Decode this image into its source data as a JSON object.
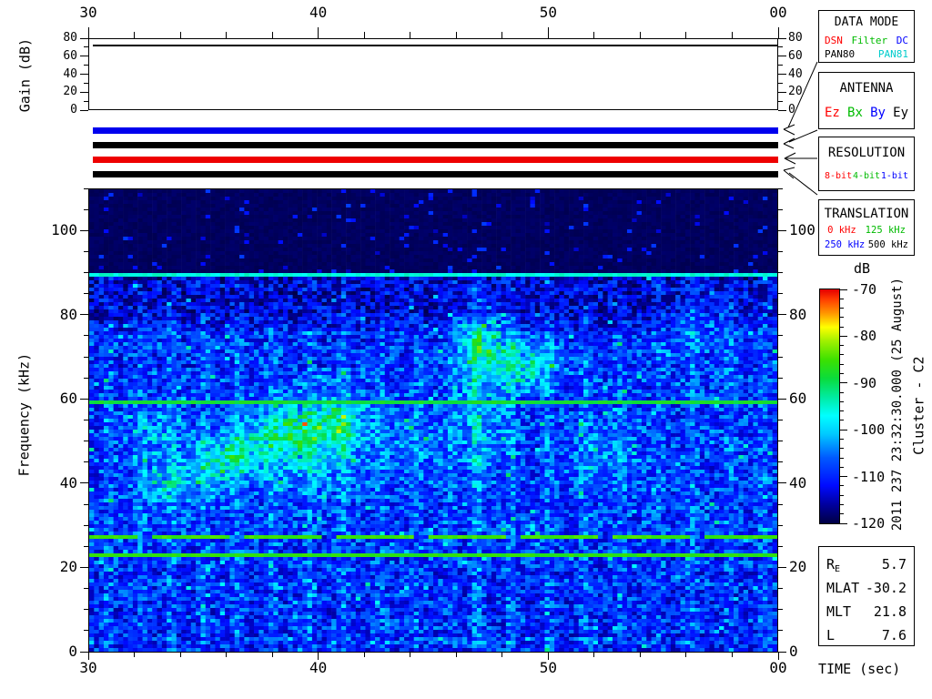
{
  "gain_panel": {
    "ylabel": "Gain (dB)",
    "tick_labels": [
      "0",
      "20",
      "40",
      "60",
      "80"
    ],
    "ymax_db": 80,
    "minor_step_db": 10,
    "major_step_db": 20,
    "trace_db": 72
  },
  "time_axis": {
    "label": "TIME (sec)",
    "tick_labels": [
      "30",
      "40",
      "50",
      "00"
    ],
    "start_sec": 30,
    "end_sec": 60,
    "minor_step_sec": 2,
    "major_step_sec": 10
  },
  "freq_axis": {
    "ylabel": "Frequency (kHz)",
    "tick_labels": [
      "0",
      "20",
      "40",
      "60",
      "80",
      "100"
    ],
    "max_khz": 110,
    "minor_step_khz": 5,
    "major_step_khz": 20
  },
  "mode_bars": [
    {
      "name": "mode-bar-blue",
      "color": "#0000ee"
    },
    {
      "name": "mode-bar-black-1",
      "color": "#000000"
    },
    {
      "name": "mode-bar-red",
      "color": "#ee0000"
    },
    {
      "name": "mode-bar-black-2",
      "color": "#000000"
    }
  ],
  "info_boxes": {
    "data_mode": {
      "title": "DATA MODE",
      "line1": [
        {
          "text": "DSN",
          "color": "#ff0000"
        },
        {
          "text": "Filter",
          "color": "#00bb00"
        },
        {
          "text": "DC",
          "color": "#0000ff"
        }
      ],
      "line2": [
        {
          "text": "PAN80",
          "color": "#000000"
        },
        {
          "text": "PAN81",
          "color": "#00cccc"
        }
      ]
    },
    "antenna": {
      "title": "ANTENNA",
      "items": [
        {
          "text": "Ez",
          "color": "#ff0000"
        },
        {
          "text": "Bx",
          "color": "#00bb00"
        },
        {
          "text": "By",
          "color": "#0000ff"
        },
        {
          "text": "Ey",
          "color": "#000000"
        }
      ]
    },
    "resolution": {
      "title": "RESOLUTION",
      "items": [
        {
          "text": "8-bit",
          "color": "#ff0000"
        },
        {
          "text": "4-bit",
          "color": "#00bb00"
        },
        {
          "text": "1-bit",
          "color": "#0000ff"
        }
      ]
    },
    "translation": {
      "title": "TRANSLATION",
      "line1": [
        {
          "text": "0 kHz",
          "color": "#ff0000"
        },
        {
          "text": "125 kHz",
          "color": "#00bb00"
        }
      ],
      "line2": [
        {
          "text": "250 kHz",
          "color": "#0000ff"
        },
        {
          "text": "500 kHz",
          "color": "#000000"
        }
      ]
    }
  },
  "colorbar": {
    "label": "dB",
    "tick_labels": [
      "-70",
      "-80",
      "-90",
      "-100",
      "-110",
      "-120"
    ],
    "max_db": -70,
    "min_db": -120,
    "minor_step_db": 2
  },
  "annotations": {
    "datetime": "2011 237 23:32:30.000 (25 August)",
    "spacecraft": "Cluster - C2"
  },
  "ephemeris": {
    "rows": [
      {
        "label": "R",
        "sub": "E",
        "value": "5.7"
      },
      {
        "label": "MLAT",
        "sub": "",
        "value": "-30.2"
      },
      {
        "label": "MLT",
        "sub": "",
        "value": "21.8"
      },
      {
        "label": "L",
        "sub": "",
        "value": "7.6"
      }
    ]
  },
  "chart_data": {
    "type": "heatmap",
    "title": "Cluster C2 wideband spectrogram",
    "xlabel": "TIME (sec)",
    "ylabel": "Frequency (kHz)",
    "x_ticks": [
      "30",
      "40",
      "50",
      "00"
    ],
    "x_range_sec": [
      30,
      60
    ],
    "y_range_khz": [
      0,
      110
    ],
    "value_range_db": [
      -120,
      -70
    ],
    "colorbar_label": "dB",
    "grid": {
      "cols": 142,
      "rows": 127
    },
    "noise": {
      "floor_db": -116,
      "spread_db": 13,
      "seed": 20110825
    },
    "upper_cutoff_khz": 90.3,
    "dark_background_db": -119.5,
    "high_band_darkening": {
      "from_khz": 76,
      "to_khz": 90,
      "amount_db": 3.5
    },
    "midband_boost": {
      "center_khz": 45,
      "sigma_khz": 25,
      "amount_db": 1.5
    },
    "spectral_lines": [
      {
        "freq_khz": 89.9,
        "level_db": -96,
        "style": "solid"
      },
      {
        "freq_khz": 58.9,
        "level_db": -89,
        "style": "solid"
      },
      {
        "freq_khz": 27.4,
        "level_db": -86,
        "style": "dashed"
      },
      {
        "freq_khz": 23.2,
        "level_db": -87,
        "style": "solid"
      }
    ],
    "stripes_sec_amp": [
      [
        30.8,
        3
      ],
      [
        32.3,
        3
      ],
      [
        33.6,
        4
      ],
      [
        35.0,
        4
      ],
      [
        36.5,
        4
      ],
      [
        38.0,
        4.5
      ],
      [
        39.6,
        4
      ],
      [
        41.1,
        4.5
      ],
      [
        42.7,
        3
      ],
      [
        44.3,
        3
      ],
      [
        45.8,
        3
      ],
      [
        46.9,
        7
      ],
      [
        48.4,
        4.5
      ],
      [
        50.0,
        4
      ],
      [
        51.6,
        4
      ],
      [
        53.2,
        3
      ],
      [
        54.8,
        3
      ],
      [
        56.3,
        4
      ],
      [
        57.9,
        3
      ],
      [
        59.4,
        3
      ]
    ],
    "blobs": [
      {
        "t_sec": 33.3,
        "f_khz": 40,
        "sig_t": 0.7,
        "sig_f": 3.5,
        "amp_db": 11
      },
      {
        "t_sec": 35.3,
        "f_khz": 42,
        "sig_t": 0.9,
        "sig_f": 4,
        "amp_db": 8
      },
      {
        "t_sec": 36.4,
        "f_khz": 47,
        "sig_t": 0.9,
        "sig_f": 4,
        "amp_db": 12
      },
      {
        "t_sec": 38.7,
        "f_khz": 52,
        "sig_t": 1.1,
        "sig_f": 5,
        "amp_db": 13
      },
      {
        "t_sec": 40.9,
        "f_khz": 55,
        "sig_t": 1.0,
        "sig_f": 5,
        "amp_db": 13
      },
      {
        "t_sec": 39.8,
        "f_khz": 46,
        "sig_t": 1.3,
        "sig_f": 6,
        "amp_db": 7
      },
      {
        "t_sec": 33.0,
        "f_khz": 52,
        "sig_t": 0.8,
        "sig_f": 4,
        "amp_db": 6
      },
      {
        "t_sec": 47.2,
        "f_khz": 72,
        "sig_t": 0.8,
        "sig_f": 6,
        "amp_db": 15
      },
      {
        "t_sec": 49.2,
        "f_khz": 68,
        "sig_t": 0.8,
        "sig_f": 4,
        "amp_db": 13
      },
      {
        "t_sec": 47.1,
        "f_khz": 55,
        "sig_t": 0.8,
        "sig_f": 8,
        "amp_db": 7
      },
      {
        "t_sec": 44.0,
        "f_khz": 50,
        "sig_t": 1.0,
        "sig_f": 6,
        "amp_db": 4
      },
      {
        "t_sec": 52.4,
        "f_khz": 47,
        "sig_t": 1.0,
        "sig_f": 5,
        "amp_db": 5
      },
      {
        "t_sec": 56.8,
        "f_khz": 78,
        "sig_t": 1.2,
        "sig_f": 5,
        "amp_db": 5
      }
    ],
    "colormap_stops": [
      [
        0.0,
        0,
        0,
        70
      ],
      [
        0.08,
        0,
        0,
        160
      ],
      [
        0.16,
        0,
        10,
        255
      ],
      [
        0.28,
        0,
        90,
        255
      ],
      [
        0.38,
        0,
        200,
        255
      ],
      [
        0.46,
        0,
        255,
        255
      ],
      [
        0.54,
        0,
        235,
        160
      ],
      [
        0.62,
        10,
        220,
        60
      ],
      [
        0.7,
        60,
        225,
        0
      ],
      [
        0.78,
        160,
        240,
        0
      ],
      [
        0.84,
        255,
        255,
        0
      ],
      [
        0.9,
        255,
        150,
        0
      ],
      [
        0.96,
        255,
        60,
        0
      ],
      [
        1.0,
        230,
        0,
        0
      ]
    ]
  }
}
